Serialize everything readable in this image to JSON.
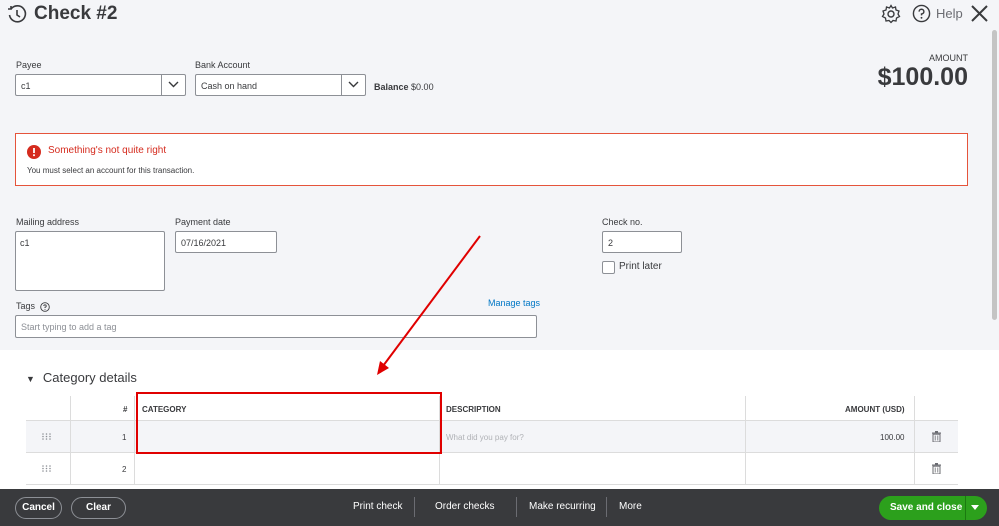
{
  "header": {
    "title": "Check #2",
    "help_label": "Help"
  },
  "payee": {
    "label": "Payee",
    "value": "c1"
  },
  "bank_account": {
    "label": "Bank Account",
    "value": "Cash on hand",
    "balance_label": "Balance",
    "balance_value": "$0.00"
  },
  "amount": {
    "label": "AMOUNT",
    "value": "$100.00"
  },
  "error": {
    "title": "Something's not quite right",
    "message": "You must select an account for this transaction."
  },
  "mailing_address": {
    "label": "Mailing address",
    "value": "c1"
  },
  "payment_date": {
    "label": "Payment date",
    "value": "07/16/2021"
  },
  "check_no": {
    "label": "Check no.",
    "value": "2",
    "print_later_label": "Print later"
  },
  "tags": {
    "label": "Tags",
    "manage_label": "Manage tags",
    "placeholder": "Start typing to add a tag"
  },
  "category_details": {
    "title": "Category details",
    "columns": {
      "num": "#",
      "category": "CATEGORY",
      "description": "DESCRIPTION",
      "amount": "AMOUNT (USD)"
    },
    "rows": [
      {
        "num": "1",
        "category": "",
        "description_placeholder": "What did you pay for?",
        "amount": "100.00"
      },
      {
        "num": "2",
        "category": "",
        "description_placeholder": "",
        "amount": ""
      }
    ]
  },
  "footer": {
    "cancel": "Cancel",
    "clear": "Clear",
    "print_check": "Print check",
    "order_checks": "Order checks",
    "make_recurring": "Make recurring",
    "more": "More",
    "save_and_close": "Save and close"
  }
}
